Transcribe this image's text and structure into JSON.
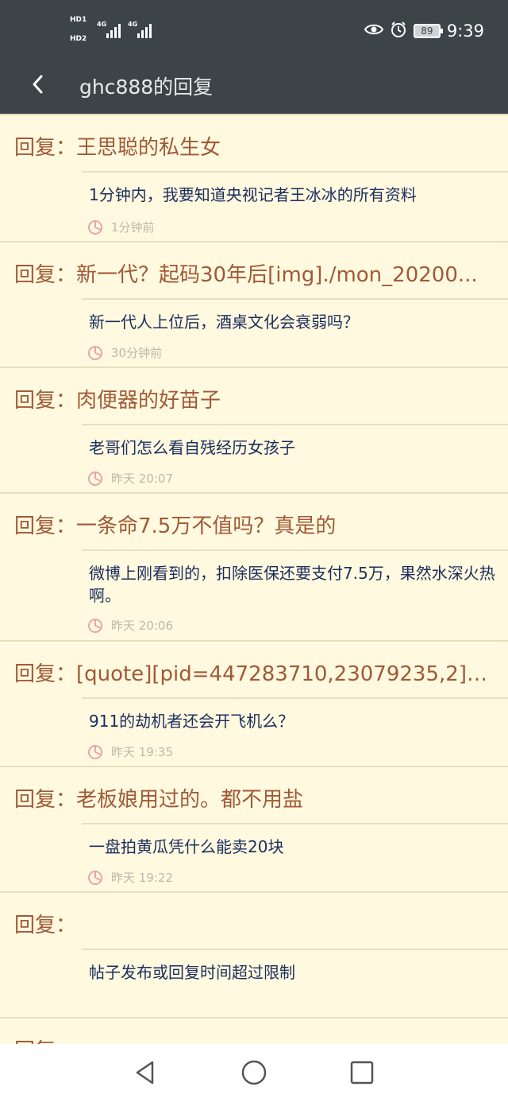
{
  "status": {
    "sim1_label": "HD1",
    "sim2_label": "HD2",
    "net1": "4G",
    "net2": "4G",
    "battery": "89",
    "time": "9:39"
  },
  "appbar": {
    "title": "ghc888的回复"
  },
  "replies": [
    {
      "title": "回复：王思聪的私生女",
      "content": "1分钟内，我要知道央视记者王冰冰的所有资料",
      "time": "1分钟前"
    },
    {
      "title": "回复：新一代？起码30年后[img]./mon_20200...",
      "content": "新一代人上位后，酒桌文化会衰弱吗？",
      "time": "30分钟前"
    },
    {
      "title": "回复：肉便器的好苗子",
      "content": "老哥们怎么看自残经历女孩子",
      "time": "昨天  20:07"
    },
    {
      "title": "回复：一条命7.5万不值吗？真是的",
      "content": "微博上刚看到的，扣除医保还要支付7.5万，果然水深火热啊。",
      "time": "昨天  20:06"
    },
    {
      "title": "回复：[quote][pid=447283710,23079235,2]Re...",
      "content": "911的劫机者还会开飞机么？",
      "time": "昨天  19:35"
    },
    {
      "title": "回复：老板娘用过的。都不用盐",
      "content": "一盘拍黄瓜凭什么能卖20块",
      "time": "昨天  19:22"
    },
    {
      "title": "回复：",
      "content": "帖子发布或回复时间超过限制",
      "time": ""
    },
    {
      "title": "回复：",
      "content": "",
      "time": ""
    }
  ],
  "icons": {
    "back": "chevron-left-icon",
    "eye": "eye-icon",
    "alarm": "alarm-clock-icon",
    "clock": "clock-icon",
    "nav_back": "triangle-back-icon",
    "nav_home": "circle-home-icon",
    "nav_recent": "square-recent-icon"
  },
  "colors": {
    "header": "#3c4448",
    "background": "#fff9e0",
    "reply_title": "#a05a36",
    "content": "#1b2d5c",
    "meta": "#c1b6a8",
    "clock_icon": "#e7a7a7"
  }
}
